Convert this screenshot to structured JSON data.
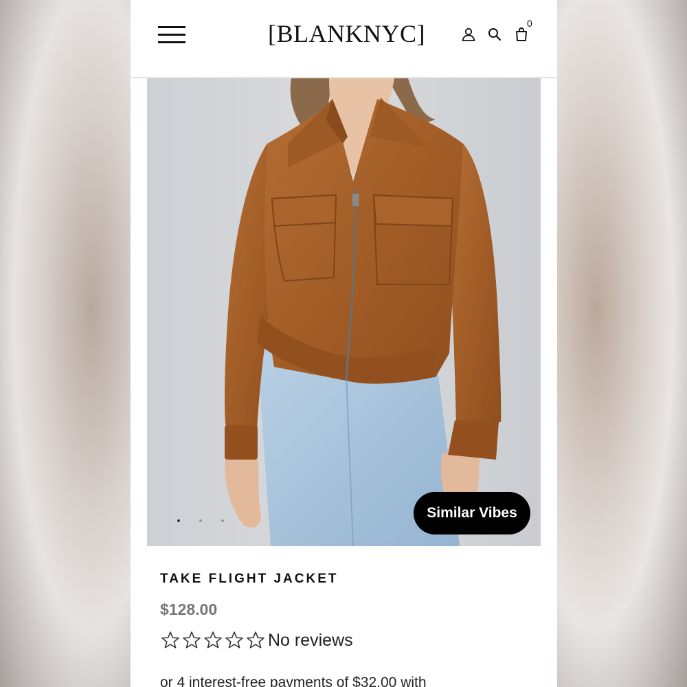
{
  "header": {
    "logo": "[BLANKNYC]",
    "cart_count": "0",
    "icons": [
      "menu-icon",
      "user-icon",
      "search-icon",
      "bag-icon"
    ]
  },
  "gallery": {
    "similar_button": "Similar Vibes",
    "current_image": 1,
    "image_count": 3
  },
  "product": {
    "title": "TAKE FLIGHT JACKET",
    "price": "$128.00",
    "rating": 0,
    "rating_max": 5,
    "reviews_label": "No reviews",
    "installments": "or 4 interest-free payments of $32.00 with"
  },
  "colors": {
    "jacket": "#a8612a",
    "denim": "#a9c4dc",
    "button_bg": "#000000",
    "price": "#777777"
  }
}
